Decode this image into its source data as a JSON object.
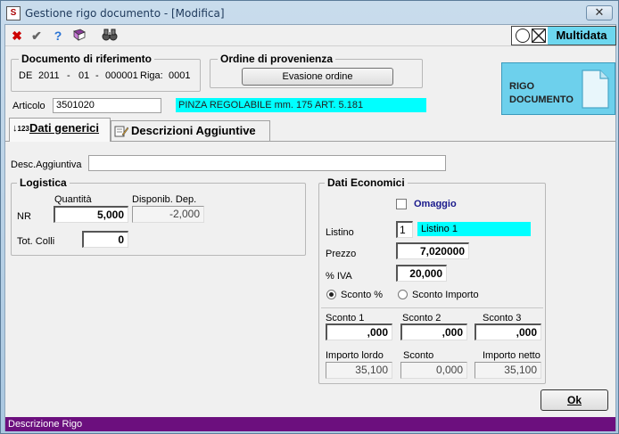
{
  "window": {
    "title": "Gestione rigo documento - [Modifica]",
    "close_label": "✕"
  },
  "toolbar": {
    "brand": "Multidata"
  },
  "documento": {
    "title": "Documento di riferimento",
    "tipo": "DE",
    "anno": "2011",
    "sep1": "-",
    "serie": "01",
    "sep2": "-",
    "numero": "000001",
    "riga_label": "Riga:",
    "riga": "0001"
  },
  "ordine": {
    "title": "Ordine di provenienza",
    "button_label": "Evasione ordine"
  },
  "rigo_documento": {
    "line1": "RIGO",
    "line2": "DOCUMENTO"
  },
  "articolo": {
    "label": "Articolo",
    "code": "3501020",
    "description": "PINZA REGOLABILE mm. 175 ART. 5.181"
  },
  "tabs": [
    {
      "label": "Dati generici"
    },
    {
      "label": "Descrizioni Aggiuntive"
    }
  ],
  "desc_aggiuntiva": {
    "label": "Desc.Aggiuntiva",
    "value": ""
  },
  "logistica": {
    "title": "Logistica",
    "quantita_label": "Quantità",
    "disponib_label": "Disponib. Dep.",
    "um": "NR",
    "quantita": "5,000",
    "disponib": "-2,000",
    "colli_label": "Tot. Colli",
    "colli": "0"
  },
  "economici": {
    "title": "Dati Economici",
    "omaggio_label": "Omaggio",
    "listino_label": "Listino",
    "listino_num": "1",
    "listino_name": "Listino 1",
    "prezzo_label": "Prezzo",
    "prezzo": "7,020000",
    "iva_label": "% IVA",
    "iva": "20,000",
    "sconto_pct_label": "Sconto %",
    "sconto_imp_label": "Sconto Importo",
    "sconto1_label": "Sconto 1",
    "sconto2_label": "Sconto 2",
    "sconto3_label": "Sconto 3",
    "sconto1": ",000",
    "sconto2": ",000",
    "sconto3": ",000",
    "lordo_label": "Importo lordo",
    "sconto_label": "Sconto",
    "netto_label": "Importo netto",
    "lordo": "35,100",
    "sconto": "0,000",
    "netto": "35,100"
  },
  "ok_label": "Ok",
  "status": "Descrizione Rigo",
  "colors": {
    "accent_cyan": "#00ffff",
    "status_purple": "#6c0f7e",
    "field_blue": "#1a1a8c"
  }
}
